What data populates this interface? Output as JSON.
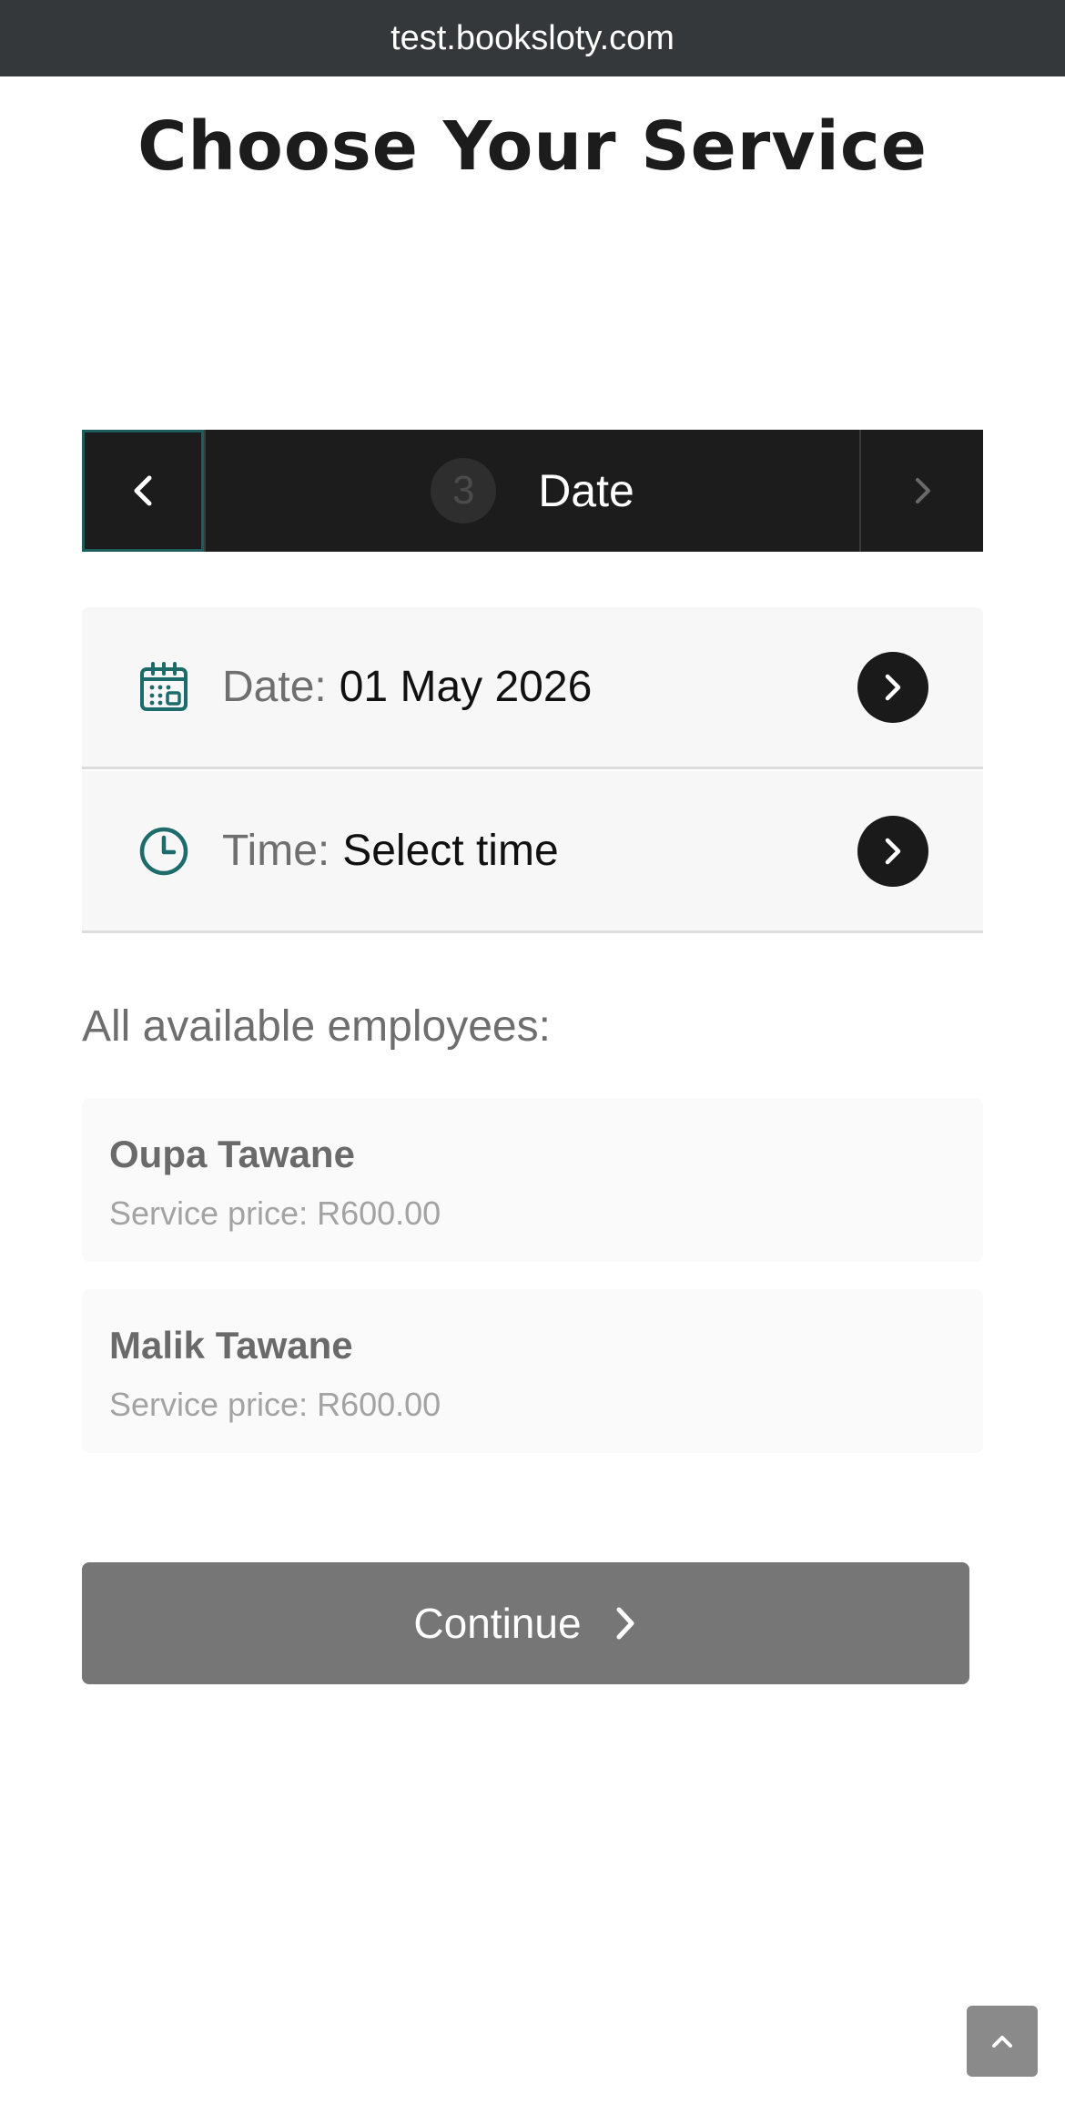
{
  "browser": {
    "url": "test.booksloty.com"
  },
  "page": {
    "title": "Choose Your Service"
  },
  "stepper": {
    "step_number": "3",
    "step_label": "Date"
  },
  "date_row": {
    "label": "Date:",
    "value": "01 May 2026"
  },
  "time_row": {
    "label": "Time:",
    "value": "Select time"
  },
  "employees": {
    "heading": "All available employees:",
    "items": [
      {
        "name": "Oupa Tawane",
        "price_text": "Service price: R600.00"
      },
      {
        "name": "Malik Tawane",
        "price_text": "Service price: R600.00"
      }
    ]
  },
  "actions": {
    "continue_label": "Continue"
  },
  "icons": {
    "prev": "chevron-left-icon",
    "next": "chevron-right-icon",
    "calendar": "calendar-icon",
    "clock": "clock-icon",
    "scroll_top": "chevron-up-icon"
  },
  "colors": {
    "accent_teal": "#1e6b6b",
    "stepper_bg": "#1c1c1c",
    "continue_bg": "#767676"
  }
}
